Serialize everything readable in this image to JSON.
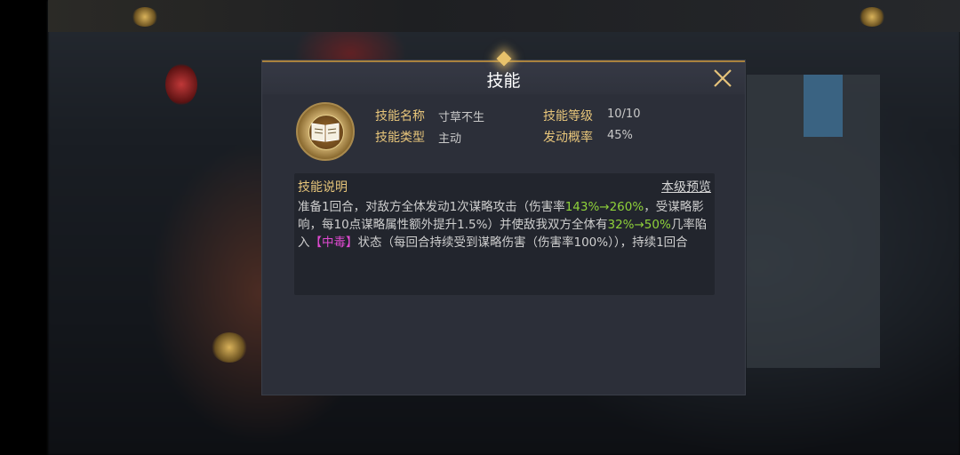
{
  "dialog": {
    "title": "技能",
    "close_icon": "close-x-icon"
  },
  "skill": {
    "icon": "book-icon",
    "name_label": "技能名称",
    "name_value": "寸草不生",
    "level_label": "技能等级",
    "level_value": "10/10",
    "type_label": "技能类型",
    "type_value": "主动",
    "chance_label": "发动概率",
    "chance_value": "45%"
  },
  "description": {
    "title": "技能说明",
    "preview_link": "本级预览",
    "segments": {
      "s1": "准备1回合，对敌方全体发动1次谋略攻击（伤害率",
      "s2": "143%→260%",
      "s3": "，受谋略影响，每10点谋略属性额外提升1.5%）并使敌我双方全体有",
      "s4": "32%→50%",
      "s5": "几率陷入",
      "s6": "【中毒】",
      "s7": "状态（每回合持续受到谋略伤害（伤害率100%）），持续1回合"
    }
  },
  "colors": {
    "gold": "#e7c57a",
    "highlight_green": "#8fd23a",
    "status_magenta": "#e04ad1"
  }
}
